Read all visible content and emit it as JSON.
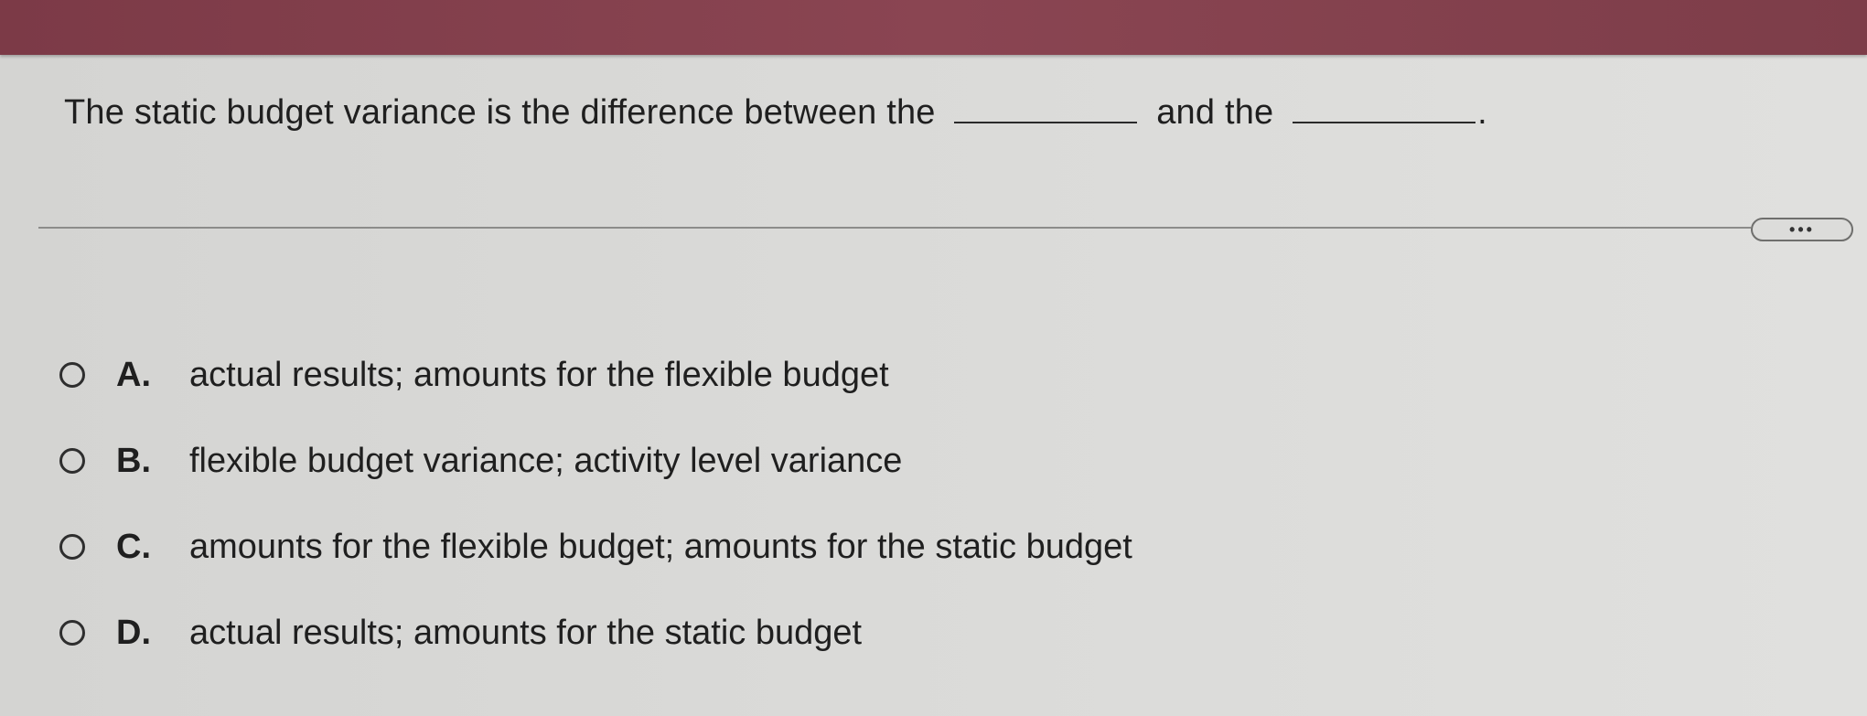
{
  "question": {
    "prefix": "The static budget variance is the difference between the",
    "middle": "and the",
    "suffix": "."
  },
  "more_button": {
    "label": "•••"
  },
  "options": [
    {
      "letter": "A.",
      "text": "actual results; amounts for the flexible budget"
    },
    {
      "letter": "B.",
      "text": "flexible budget variance; activity level variance"
    },
    {
      "letter": "C.",
      "text": "amounts for the flexible budget; amounts for the static budget"
    },
    {
      "letter": "D.",
      "text": "actual results; amounts for the static budget"
    }
  ],
  "colors": {
    "top_bar": "#86404d",
    "background": "#dadad8",
    "text": "#1f1f1f"
  }
}
